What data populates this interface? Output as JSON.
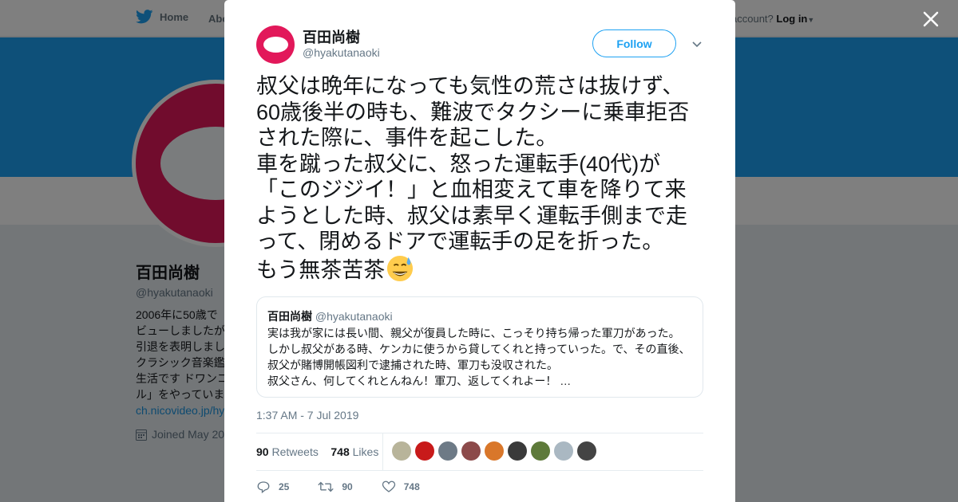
{
  "topnav": {
    "home_label": "Home",
    "about_label": "Abo",
    "account_prompt": "account?",
    "login_label": "Log in"
  },
  "profile": {
    "name": "百田尚樹",
    "handle": "@hyakutanaoki",
    "bio_lines": [
      "2006年に50歳で",
      "ビューしましたが",
      "引退を表明しまし",
      "クラシック音楽鑑",
      "生活です ドワンコ",
      "ル」をやっていま"
    ],
    "link": "ch.nicovideo.jp/hy",
    "joined": "Joined May 20"
  },
  "tweet": {
    "author_name": "百田尚樹",
    "author_handle": "@hyakutanaoki",
    "follow_label": "Follow",
    "text": "叔父は晩年になっても気性の荒さは抜けず、\n60歳後半の時も、難波でタクシーに乗車拒否\nされた際に、事件を起こした。\n車を蹴った叔父に、怒った運転手(40代)が\n「このジジイ！」と血相変えて車を降りて来\nようとした時、叔父は素早く運転手側まで走\nって、閉めるドアで運転手の足を折った。\nもう無茶苦茶",
    "quoted": {
      "name": "百田尚樹",
      "handle": "@hyakutanaoki",
      "text": "実は我が家には長い間、親父が復員した時に、こっそり持ち帰った軍刀があった。\nしかし叔父がある時、ケンカに使うから貸してくれと持っていった。で、その直後、\n叔父が賭博開帳図利で逮捕された時、軍刀も没収された。\n叔父さん、何してくれとんねん！軍刀、返してくれよー！ …"
    },
    "timestamp": "1:37 AM - 7 Jul 2019",
    "retweets_count": "90",
    "retweets_label": "Retweets",
    "likes_count": "748",
    "likes_label": "Likes",
    "liker_colors": [
      "#b8b49a",
      "#c81a1a",
      "#6d7a86",
      "#8c4a4a",
      "#d9772a",
      "#3a3a3a",
      "#5e7a3a",
      "#aab8c2",
      "#444444"
    ],
    "replies": "25",
    "retweets_action": "90",
    "likes_action": "748"
  },
  "colors": {
    "accent": "#1da1f2",
    "avatar": "#e2185a"
  }
}
